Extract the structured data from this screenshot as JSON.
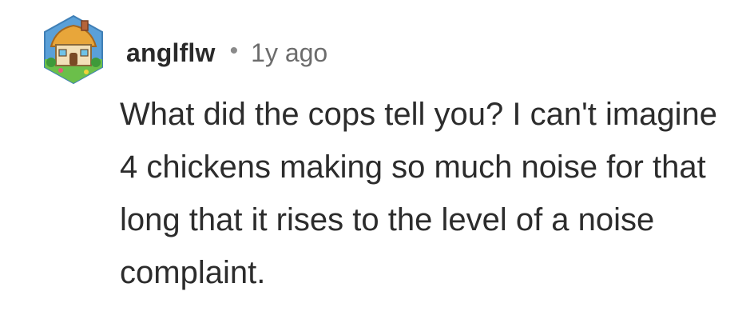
{
  "comment": {
    "username": "anglflw",
    "separator": "•",
    "timestamp": "1y ago",
    "text": "What did the cops tell you? I can't imagine 4 chickens making so much noise for that long that it rises to the level of a noise complaint.",
    "avatar_icon": "cottage-house-avatar-icon"
  }
}
